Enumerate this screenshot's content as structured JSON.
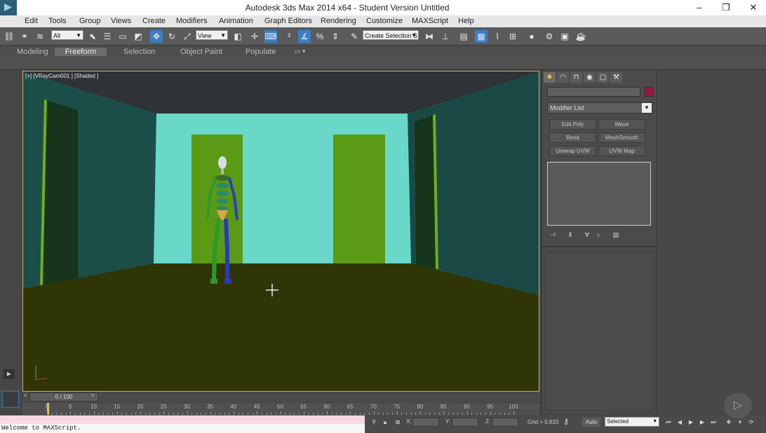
{
  "window": {
    "title": "Autodesk 3ds Max  2014 x64 - Student Version    Untitled",
    "minimize": "–",
    "restore": "❐",
    "close": "✕"
  },
  "menu": [
    "Edit",
    "Tools",
    "Group",
    "Views",
    "Create",
    "Modifiers",
    "Animation",
    "Graph Editors",
    "Rendering",
    "Customize",
    "MAXScript",
    "Help"
  ],
  "toolbar": {
    "selection_filter": "All",
    "reference_coord": "View",
    "named_selection": "Create Selection S"
  },
  "ribbon_tabs": [
    "Modeling",
    "Freeform",
    "Selection",
    "Object Paint",
    "Populate"
  ],
  "ribbon_active": "Freeform",
  "viewport": {
    "label": "[+] [VRayCam001 ] [Shaded ]"
  },
  "command_panel": {
    "modifier_list": "Modifier List",
    "modifier_buttons": [
      "Edit Poly",
      "Wave",
      "Bend",
      "MeshSmooth",
      "Unwrap UVW",
      "UVW Map"
    ],
    "swatch_color": "#9b1544"
  },
  "timeline": {
    "frame_display": "0 / 100",
    "prev": "<",
    "next": ">",
    "ticks": [
      "0",
      "5",
      "10",
      "15",
      "20",
      "25",
      "30",
      "35",
      "40",
      "45",
      "50",
      "55",
      "60",
      "65",
      "70",
      "75",
      "80",
      "85",
      "90",
      "95",
      "100"
    ]
  },
  "status": {
    "listener_text": "Welcome to MAXScript.",
    "x_label": "X:",
    "y_label": "Y:",
    "z_label": "Z:",
    "grid": "Grid = 0.833",
    "auto_key": "Auto",
    "key_filter": "Selected"
  }
}
